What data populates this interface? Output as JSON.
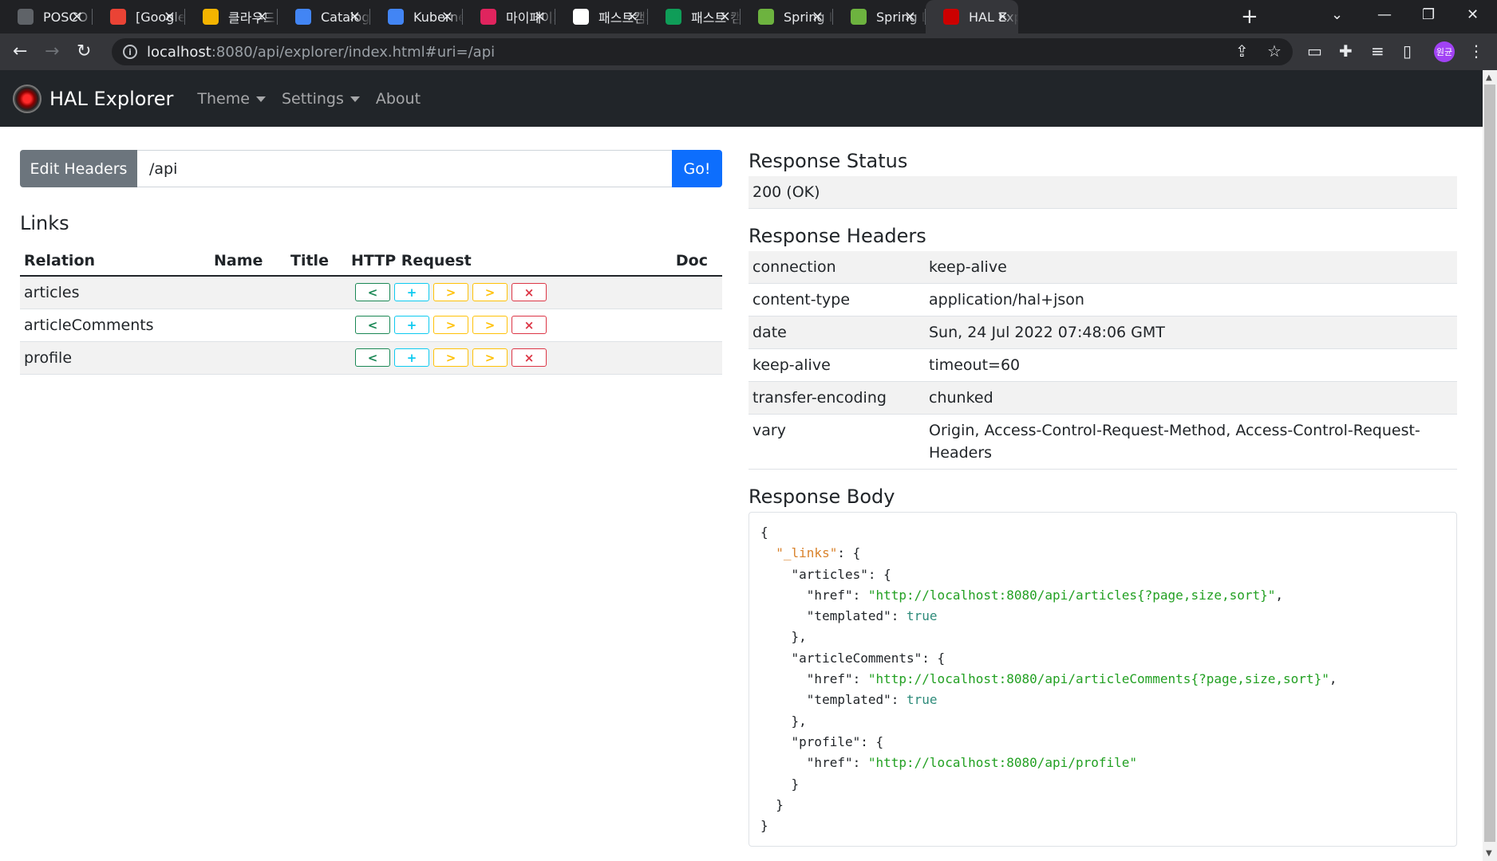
{
  "browser": {
    "tabs": [
      {
        "title": "POSCO ICT",
        "favicon": "globe-icon",
        "color": "#5f6368"
      },
      {
        "title": "[Google",
        "favicon": "gmail-icon",
        "color": "#ea4335"
      },
      {
        "title": "클라우드",
        "favicon": "slides-icon",
        "color": "#f4b400"
      },
      {
        "title": "Catalog",
        "favicon": "gcloud-icon",
        "color": "#4285f4"
      },
      {
        "title": "Kubernetes",
        "favicon": "gcloud-icon",
        "color": "#4285f4"
      },
      {
        "title": "마이페이지",
        "favicon": "app-icon",
        "color": "#e0245e"
      },
      {
        "title": "패스트캠퍼스",
        "favicon": "github-icon",
        "color": "#ffffff"
      },
      {
        "title": "패스트 캠퍼스",
        "favicon": "sheets-icon",
        "color": "#0f9d58"
      },
      {
        "title": "Spring Initializr",
        "favicon": "spring-icon",
        "color": "#6db33f"
      },
      {
        "title": "Spring Data",
        "favicon": "spring-icon",
        "color": "#6db33f"
      },
      {
        "title": "HAL Explorer",
        "favicon": "hal-icon",
        "color": "#cc0000"
      }
    ],
    "url_host": "localhost",
    "url_rest": ":8080/api/explorer/index.html#uri=/api",
    "profile_initials": "원균"
  },
  "navbar": {
    "brand": "HAL Explorer",
    "menu": [
      "Theme",
      "Settings",
      "About"
    ]
  },
  "request": {
    "edit_headers_label": "Edit Headers",
    "uri_value": "/api",
    "go_label": "Go!"
  },
  "links": {
    "title": "Links",
    "columns": [
      "Relation",
      "Name",
      "Title",
      "HTTP Request",
      "Doc"
    ],
    "rows": [
      {
        "relation": "articles",
        "name": "",
        "title": ""
      },
      {
        "relation": "articleComments",
        "name": "",
        "title": ""
      },
      {
        "relation": "profile",
        "name": "",
        "title": ""
      }
    ],
    "buttons": {
      "get": "<",
      "post": "+",
      "put": ">",
      "patch": ">",
      "delete": "×"
    }
  },
  "response": {
    "status_title": "Response Status",
    "status": "200 (OK)",
    "headers_title": "Response Headers",
    "headers": [
      {
        "key": "connection",
        "value": "keep-alive"
      },
      {
        "key": "content-type",
        "value": "application/hal+json"
      },
      {
        "key": "date",
        "value": "Sun, 24 Jul 2022 07:48:06 GMT"
      },
      {
        "key": "keep-alive",
        "value": "timeout=60"
      },
      {
        "key": "transfer-encoding",
        "value": "chunked"
      },
      {
        "key": "vary",
        "value": "Origin, Access-Control-Request-Method, Access-Control-Request-Headers"
      }
    ],
    "body_title": "Response Body",
    "body_lines": [
      [
        {
          "t": "{",
          "c": "p"
        }
      ],
      [
        {
          "t": "  ",
          "c": "p"
        },
        {
          "t": "\"_links\"",
          "c": "jk-top"
        },
        {
          "t": ": {",
          "c": "p"
        }
      ],
      [
        {
          "t": "    \"articles\": {",
          "c": "p"
        }
      ],
      [
        {
          "t": "      \"href\": ",
          "c": "p"
        },
        {
          "t": "\"http://localhost:8080/api/articles{?page,size,sort}\"",
          "c": "js"
        },
        {
          "t": ",",
          "c": "p"
        }
      ],
      [
        {
          "t": "      \"templated\": ",
          "c": "p"
        },
        {
          "t": "true",
          "c": "jb"
        }
      ],
      [
        {
          "t": "    },",
          "c": "p"
        }
      ],
      [
        {
          "t": "    \"articleComments\": {",
          "c": "p"
        }
      ],
      [
        {
          "t": "      \"href\": ",
          "c": "p"
        },
        {
          "t": "\"http://localhost:8080/api/articleComments{?page,size,sort}\"",
          "c": "js"
        },
        {
          "t": ",",
          "c": "p"
        }
      ],
      [
        {
          "t": "      \"templated\": ",
          "c": "p"
        },
        {
          "t": "true",
          "c": "jb"
        }
      ],
      [
        {
          "t": "    },",
          "c": "p"
        }
      ],
      [
        {
          "t": "    \"profile\": {",
          "c": "p"
        }
      ],
      [
        {
          "t": "      \"href\": ",
          "c": "p"
        },
        {
          "t": "\"http://localhost:8080/api/profile\"",
          "c": "js"
        }
      ],
      [
        {
          "t": "    }",
          "c": "p"
        }
      ],
      [
        {
          "t": "  }",
          "c": "p"
        }
      ],
      [
        {
          "t": "}",
          "c": "p"
        }
      ]
    ]
  }
}
